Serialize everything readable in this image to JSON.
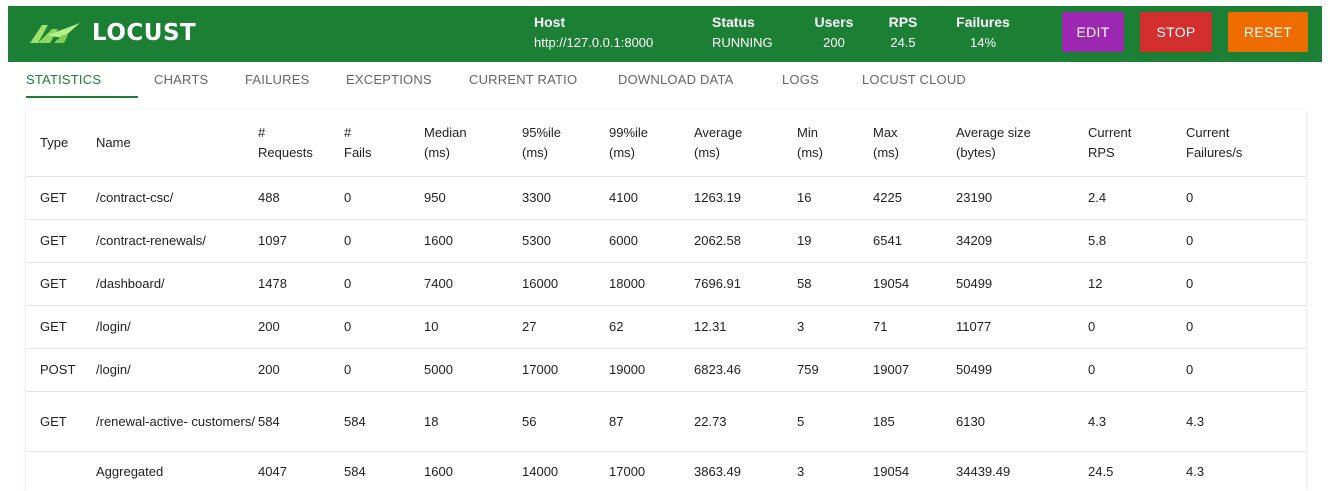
{
  "header": {
    "logo_text": "LOCUST",
    "host": {
      "label": "Host",
      "value": "http://127.0.0.1:8000"
    },
    "status": {
      "label": "Status",
      "value": "RUNNING"
    },
    "users": {
      "label": "Users",
      "value": "200"
    },
    "rps": {
      "label": "RPS",
      "value": "24.5"
    },
    "failures": {
      "label": "Failures",
      "value": "14%"
    },
    "buttons": {
      "edit": "EDIT",
      "stop": "STOP",
      "reset": "RESET"
    },
    "colors": {
      "bar": "#1b8034",
      "edit": "#9c27b0",
      "stop": "#d32f2f",
      "reset": "#ef6c00"
    }
  },
  "tabs": [
    "STATISTICS",
    "CHARTS",
    "FAILURES",
    "EXCEPTIONS",
    "CURRENT RATIO",
    "DOWNLOAD DATA",
    "LOGS",
    "LOCUST CLOUD"
  ],
  "table": {
    "headers": [
      [
        "Type"
      ],
      [
        "Name"
      ],
      [
        "#",
        "Requests"
      ],
      [
        "#",
        "Fails"
      ],
      [
        "Median",
        "(ms)"
      ],
      [
        "95%ile",
        "(ms)"
      ],
      [
        "99%ile",
        "(ms)"
      ],
      [
        "Average",
        "(ms)"
      ],
      [
        "Min",
        "(ms)"
      ],
      [
        "Max",
        "(ms)"
      ],
      [
        "Average size",
        "(bytes)"
      ],
      [
        "Current",
        "RPS"
      ],
      [
        "Current",
        "Failures/s"
      ]
    ],
    "rows": [
      [
        "GET",
        "/contract-csc/",
        "488",
        "0",
        "950",
        "3300",
        "4100",
        "1263.19",
        "16",
        "4225",
        "23190",
        "2.4",
        "0"
      ],
      [
        "GET",
        "/contract-renewals/",
        "1097",
        "0",
        "1600",
        "5300",
        "6000",
        "2062.58",
        "19",
        "6541",
        "34209",
        "5.8",
        "0"
      ],
      [
        "GET",
        "/dashboard/",
        "1478",
        "0",
        "7400",
        "16000",
        "18000",
        "7696.91",
        "58",
        "19054",
        "50499",
        "12",
        "0"
      ],
      [
        "GET",
        "/login/",
        "200",
        "0",
        "10",
        "27",
        "62",
        "12.31",
        "3",
        "71",
        "11077",
        "0",
        "0"
      ],
      [
        "POST",
        "/login/",
        "200",
        "0",
        "5000",
        "17000",
        "19000",
        "6823.46",
        "759",
        "19007",
        "50499",
        "0",
        "0"
      ],
      [
        "GET",
        "/renewal-active- customers/",
        "584",
        "584",
        "18",
        "56",
        "87",
        "22.73",
        "5",
        "185",
        "6130",
        "4.3",
        "4.3"
      ],
      [
        "",
        "Aggregated",
        "4047",
        "584",
        "1600",
        "14000",
        "17000",
        "3863.49",
        "3",
        "19054",
        "34439.49",
        "24.5",
        "4.3"
      ]
    ]
  }
}
